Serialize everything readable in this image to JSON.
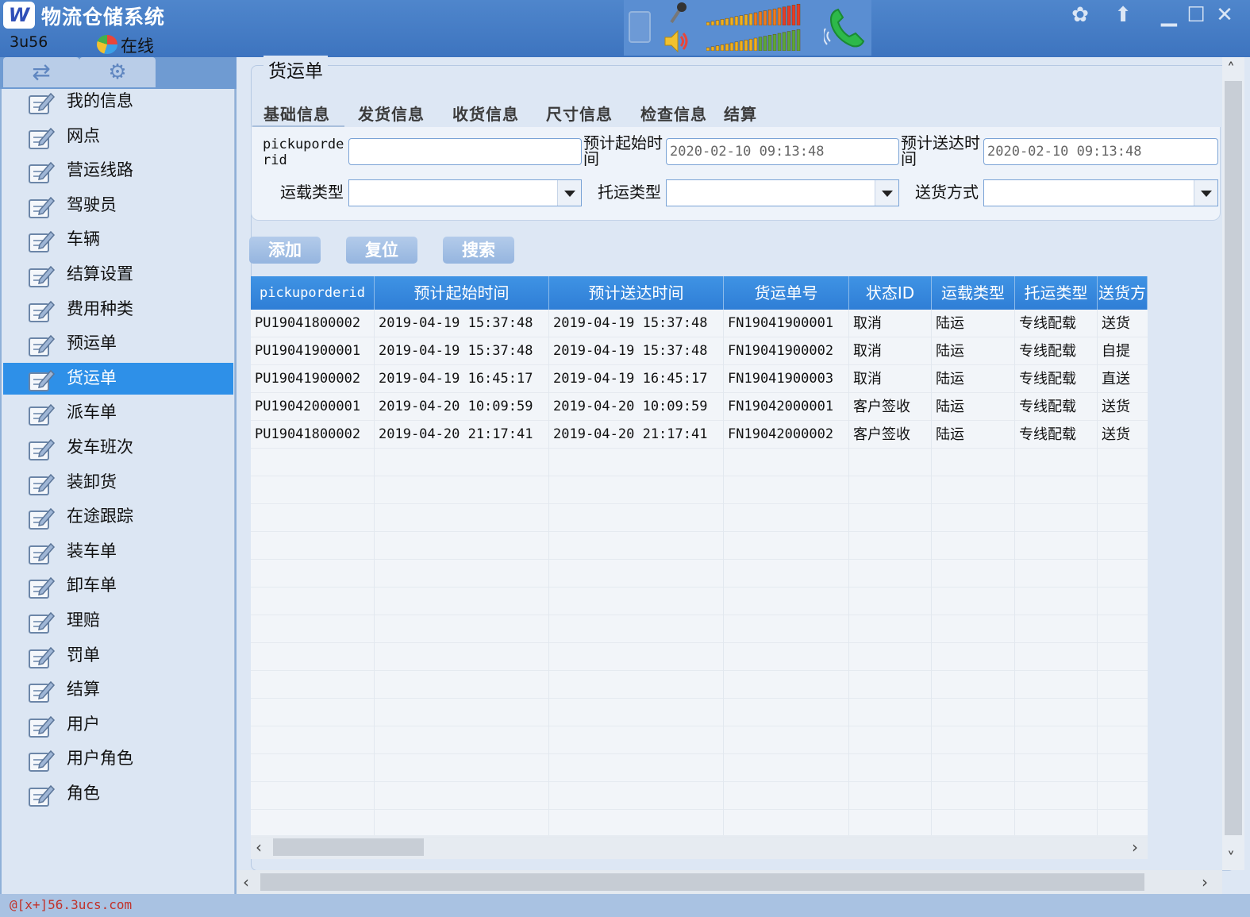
{
  "window": {
    "title": "物流仓储系统",
    "logo_text": "W",
    "user": "3u56",
    "status": "在线",
    "controls": [
      "skin-icon",
      "upload-icon",
      "minimize-icon",
      "maximize-icon",
      "close-icon"
    ]
  },
  "sidebar": {
    "top_tabs": [
      "switch-icon",
      "settings-icon"
    ],
    "items": [
      {
        "label": "我的信息"
      },
      {
        "label": "网点"
      },
      {
        "label": "营运线路"
      },
      {
        "label": "驾驶员"
      },
      {
        "label": "车辆"
      },
      {
        "label": "结算设置"
      },
      {
        "label": "费用种类"
      },
      {
        "label": "预运单"
      },
      {
        "label": "货运单",
        "active": true
      },
      {
        "label": "派车单"
      },
      {
        "label": "发车班次"
      },
      {
        "label": "装卸货"
      },
      {
        "label": "在途跟踪"
      },
      {
        "label": "装车单"
      },
      {
        "label": "卸车单"
      },
      {
        "label": "理赔"
      },
      {
        "label": "罚单"
      },
      {
        "label": "结算"
      },
      {
        "label": "用户"
      },
      {
        "label": "用户角色"
      },
      {
        "label": "角色"
      }
    ]
  },
  "form": {
    "title": "货运单",
    "tabs": [
      "基础信息",
      "发货信息",
      "收货信息",
      "尺寸信息",
      "检查信息",
      "结算"
    ],
    "fields": {
      "pickuporderid_label_1": "pickuporde",
      "pickuporderid_label_2": "rid",
      "pickuporderid_value": "",
      "start_time_label_1": "预计起始时",
      "start_time_label_2": "间",
      "start_time_value": "2020-02-10 09:13:48",
      "arrive_time_label_1": "预计送达时",
      "arrive_time_label_2": "间",
      "arrive_time_value": "2020-02-10 09:13:48",
      "transport_type_label": "运载类型",
      "consign_type_label": "托运类型",
      "delivery_method_label": "送货方式"
    },
    "buttons": {
      "add": "添加",
      "reset": "复位",
      "search": "搜索"
    }
  },
  "grid": {
    "columns": [
      "pickuporderid",
      "预计起始时间",
      "预计送达时间",
      "货运单号",
      "状态ID",
      "运载类型",
      "托运类型",
      "送货方"
    ],
    "rows": [
      [
        "PU19041800002",
        "2019-04-19 15:37:48",
        "2019-04-19 15:37:48",
        "FN19041900001",
        "取消",
        "陆运",
        "专线配载",
        "送货"
      ],
      [
        "PU19041900001",
        "2019-04-19 15:37:48",
        "2019-04-19 15:37:48",
        "FN19041900002",
        "取消",
        "陆运",
        "专线配载",
        "自提"
      ],
      [
        "PU19041900002",
        "2019-04-19 16:45:17",
        "2019-04-19 16:45:17",
        "FN19041900003",
        "取消",
        "陆运",
        "专线配载",
        "直送"
      ],
      [
        "PU19042000001",
        "2019-04-20 10:09:59",
        "2019-04-20 10:09:59",
        "FN19042000001",
        "客户签收",
        "陆运",
        "专线配载",
        "送货"
      ],
      [
        "PU19041800002",
        "2019-04-20 21:17:41",
        "2019-04-20 21:17:41",
        "FN19042000002",
        "客户签收",
        "陆运",
        "专线配载",
        "送货"
      ]
    ]
  },
  "statusbar": {
    "url": "@[x+]56.3ucs.com"
  },
  "colors": {
    "titlebar": "#3d74bf",
    "active_item": "#2e90e8",
    "header": "#2f7ed6",
    "url": "#c1322a"
  }
}
